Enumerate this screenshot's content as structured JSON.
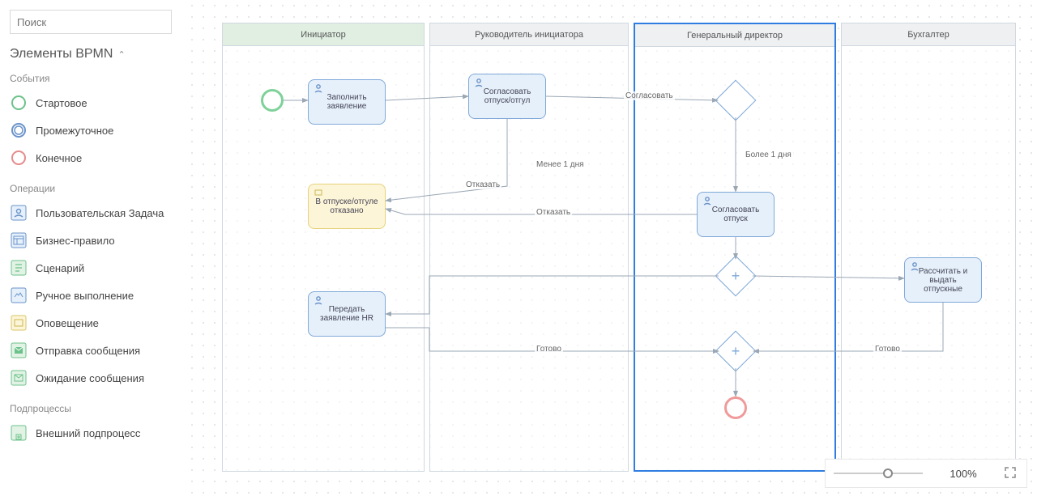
{
  "sidebar": {
    "search_placeholder": "Поиск",
    "panel_title": "Элементы BPMN",
    "groups": {
      "events": {
        "label": "События",
        "items": [
          "Стартовое",
          "Промежуточное",
          "Конечное"
        ]
      },
      "ops": {
        "label": "Операции",
        "items": [
          "Пользовательская Задача",
          "Бизнес-правило",
          "Сценарий",
          "Ручное выполнение",
          "Оповещение",
          "Отправка сообщения",
          "Ожидание сообщения"
        ]
      },
      "sub": {
        "label": "Подпроцессы",
        "items": [
          "Внешний подпроцесс"
        ]
      }
    }
  },
  "lanes": [
    "Инициатор",
    "Руководитель инициатора",
    "Генеральный директор",
    "Бухгалтер"
  ],
  "tasks": {
    "t1": "Заполнить заявление",
    "t2": "Согласовать отпуск/отгул",
    "t3": "В отпуске/отгуле отказано",
    "t4": "Передать заявление HR",
    "t5": "Согласовать отпуск",
    "t6": "Рассчитать и выдать отпускные"
  },
  "edge_labels": {
    "e1": "Согласовать",
    "e2": "Более 1 дня",
    "e3": "Менее 1 дня",
    "e4": "Отказать",
    "e5": "Отказать",
    "e6": "Готово",
    "e7": "Готово"
  },
  "zoom": {
    "label": "100%",
    "thumb_pct": 55
  }
}
